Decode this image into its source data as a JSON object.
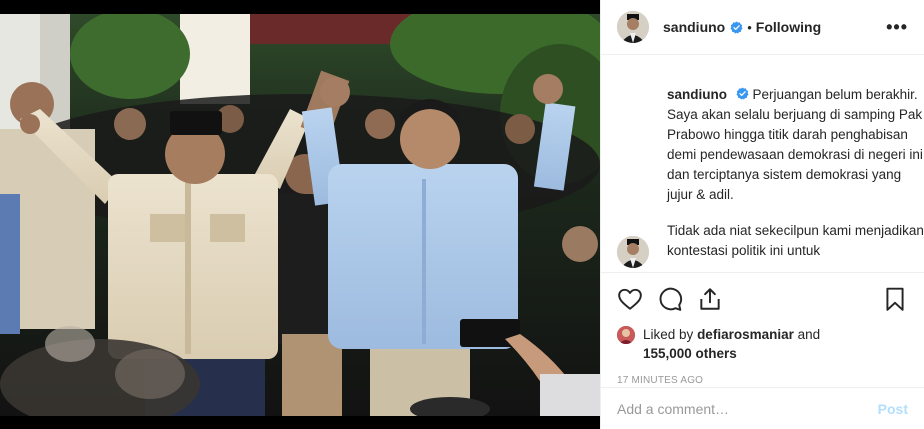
{
  "post": {
    "username": "sandiuno",
    "follow_state": "Following",
    "separator": "•",
    "more_label": "•••",
    "caption_username": "sandiuno",
    "caption_paragraph_1": "Perjuangan belum berakhir. Saya akan selalu berjuang di samping Pak Prabowo hingga titik darah penghabisan demi pendewasaan demokrasi di negeri ini dan terciptanya sistem demokrasi yang jujur & adil.",
    "caption_paragraph_2": "Tidak ada niat sekecilpun kami menjadikan kontestasi politik ini untuk",
    "liked_by_prefix": "Liked by",
    "liked_by_user": "defiarosmaniar",
    "liked_by_and": "and",
    "liked_by_others": "155,000 others",
    "timestamp": "17 MINUTES AGO",
    "comment_placeholder": "Add a comment…",
    "post_button": "Post"
  },
  "icons": {
    "verified": "verified-badge-icon",
    "like": "heart-icon",
    "comment": "comment-bubble-icon",
    "share": "share-icon",
    "save": "bookmark-icon"
  },
  "colors": {
    "verified_blue": "#3897f0",
    "post_button_disabled": "#b2dffc",
    "muted_text": "#999999"
  }
}
